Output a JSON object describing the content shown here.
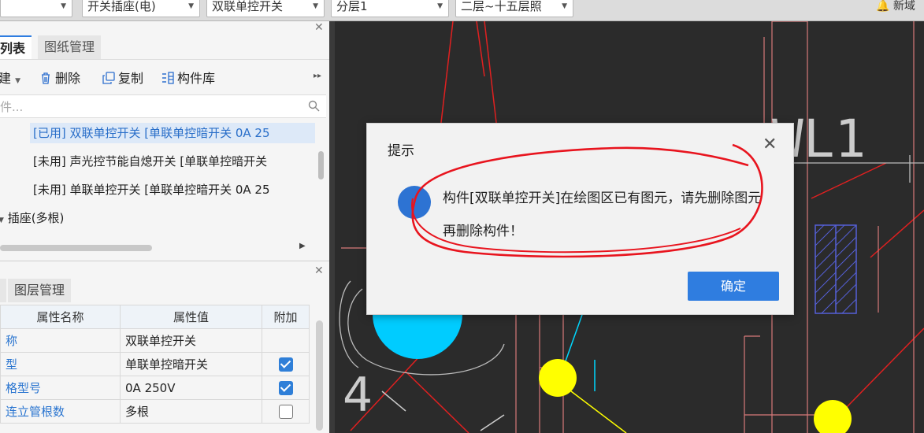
{
  "toolbar": {
    "combo1": "开关插座(电)",
    "combo2": "双联单控开关",
    "combo3": "分层1",
    "combo4": "二层~十五层照",
    "new_label": "新域"
  },
  "left_panel": {
    "tabs": [
      "列表",
      "图纸管理"
    ],
    "actions": {
      "new": "建",
      "delete": "删除",
      "copy": "复制",
      "library": "构件库"
    },
    "search_placeholder": "件...",
    "tree_items": [
      {
        "text": "[已用] 双联单控开关 [单联单控暗开关 0A 25",
        "selected": true
      },
      {
        "text": "[未用] 声光控节能自熄开关 [单联单控暗开关",
        "selected": false
      },
      {
        "text": "[未用] 单联单控开关 [单联单控暗开关 0A 25",
        "selected": false
      }
    ],
    "group": "插座(多根)",
    "prop_tabs": [
      "图层管理"
    ],
    "prop_headers": [
      "属性名称",
      "属性值",
      "附加"
    ],
    "props": [
      {
        "name": "称",
        "value": "双联单控开关",
        "extra": ""
      },
      {
        "name": "型",
        "value": "单联单控暗开关",
        "extra": "checked"
      },
      {
        "name": "格型号",
        "value": "0A 250V",
        "extra": "checked"
      },
      {
        "name": "连立管根数",
        "value": "多根",
        "extra": "unchecked"
      }
    ]
  },
  "canvas": {
    "label_wl": "WL1",
    "label_4": "4",
    "colors": {
      "background": "#2b2b2b",
      "red_line": "#e02020",
      "pink_line": "#d87a7a",
      "cyan": "#00d8ff",
      "yellow": "#ffff00",
      "blue_hatch": "#5560d8"
    }
  },
  "dialog": {
    "title": "提示",
    "message": "构件[双联单控开关]在绘图区已有图元，请先删除图元再删除构件！",
    "ok": "确定"
  }
}
